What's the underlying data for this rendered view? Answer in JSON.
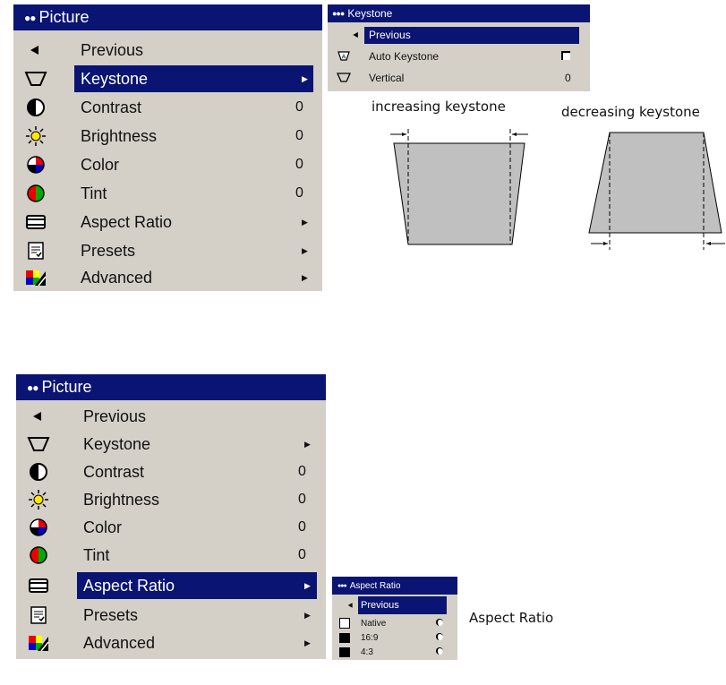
{
  "picture_menu_top": {
    "title": "Picture",
    "items": [
      {
        "label": "Previous",
        "value": "",
        "icon": "previous-arrow-icon"
      },
      {
        "label": "Keystone",
        "value": "",
        "icon": "keystone-icon",
        "submenu": true
      },
      {
        "label": "Contrast",
        "value": "0",
        "icon": "contrast-icon"
      },
      {
        "label": "Brightness",
        "value": "0",
        "icon": "brightness-icon"
      },
      {
        "label": "Color",
        "value": "0",
        "icon": "color-icon"
      },
      {
        "label": "Tint",
        "value": "0",
        "icon": "tint-icon"
      },
      {
        "label": "Aspect Ratio",
        "value": "",
        "icon": "aspect-ratio-icon",
        "submenu": true
      },
      {
        "label": "Presets",
        "value": "",
        "icon": "presets-icon",
        "submenu": true
      },
      {
        "label": "Advanced",
        "value": "",
        "icon": "advanced-icon",
        "submenu": true
      }
    ],
    "selected": "Keystone"
  },
  "keystone_menu": {
    "title": "Keystone",
    "items": [
      {
        "label": "Previous",
        "value": ""
      },
      {
        "label": "Auto Keystone",
        "value": ""
      },
      {
        "label": "Vertical",
        "value": "0"
      }
    ],
    "selected": "Previous",
    "auto_keystone_checked": false
  },
  "captions": {
    "increasing": "increasing keystone",
    "decreasing": "decreasing keystone",
    "aspect_ratio": "Aspect Ratio"
  },
  "picture_menu_bottom": {
    "title": "Picture",
    "items": [
      {
        "label": "Previous",
        "value": ""
      },
      {
        "label": "Keystone",
        "value": ""
      },
      {
        "label": "Contrast",
        "value": "0"
      },
      {
        "label": "Brightness",
        "value": "0"
      },
      {
        "label": "Color",
        "value": "0"
      },
      {
        "label": "Tint",
        "value": "0"
      },
      {
        "label": "Aspect Ratio",
        "value": ""
      },
      {
        "label": "Presets",
        "value": ""
      },
      {
        "label": "Advanced",
        "value": ""
      }
    ],
    "selected": "Aspect Ratio"
  },
  "aspect_menu": {
    "title": "Aspect Ratio",
    "items": [
      {
        "label": "Previous"
      },
      {
        "label": "Native"
      },
      {
        "label": "16:9"
      },
      {
        "label": "4:3"
      }
    ],
    "selected": "Previous"
  },
  "colors": {
    "menu_bg": "#d4d0c8",
    "title_bg": "#0a1472",
    "highlight": "#0a1472",
    "diagram_fill": "#c0c0c0"
  }
}
